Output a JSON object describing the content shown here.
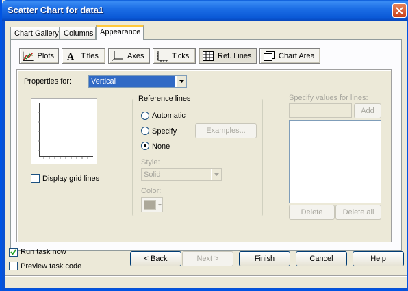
{
  "window": {
    "title": "Scatter Chart for data1"
  },
  "tabs": [
    {
      "label": "Chart Gallery",
      "active": false
    },
    {
      "label": "Columns",
      "active": false
    },
    {
      "label": "Appearance",
      "active": true
    }
  ],
  "toolbar": [
    {
      "label": "Plots",
      "icon": "plots-icon",
      "pressed": false
    },
    {
      "label": "Titles",
      "icon": "titles-icon",
      "pressed": false
    },
    {
      "label": "Axes",
      "icon": "axes-icon",
      "pressed": false
    },
    {
      "label": "Ticks",
      "icon": "ticks-icon",
      "pressed": false
    },
    {
      "label": "Ref. Lines",
      "icon": "ref-lines-icon",
      "pressed": true
    },
    {
      "label": "Chart Area",
      "icon": "chart-area-icon",
      "pressed": false
    }
  ],
  "properties": {
    "label": "Properties for:",
    "value": "Vertical"
  },
  "display_grid": {
    "label": "Display grid lines",
    "checked": false
  },
  "reference_lines": {
    "legend": "Reference lines",
    "options": [
      {
        "label": "Automatic",
        "selected": false
      },
      {
        "label": "Specify",
        "selected": false
      },
      {
        "label": "None",
        "selected": true
      }
    ],
    "examples_label": "Examples...",
    "style_label": "Style:",
    "style_value": "Solid",
    "color_label": "Color:"
  },
  "values_panel": {
    "label": "Specify values for lines:",
    "add_label": "Add",
    "delete_label": "Delete",
    "delete_all_label": "Delete all"
  },
  "footer": {
    "run_task": {
      "label": "Run task now",
      "checked": true
    },
    "preview_code": {
      "label": "Preview task code",
      "checked": false
    },
    "buttons": {
      "back": "< Back",
      "next": "Next >",
      "finish": "Finish",
      "cancel": "Cancel",
      "help": "Help"
    }
  },
  "colors": {
    "titlebar": "#0a58d6",
    "selection": "#316ac5",
    "tab_highlight": "#ffc83c"
  }
}
